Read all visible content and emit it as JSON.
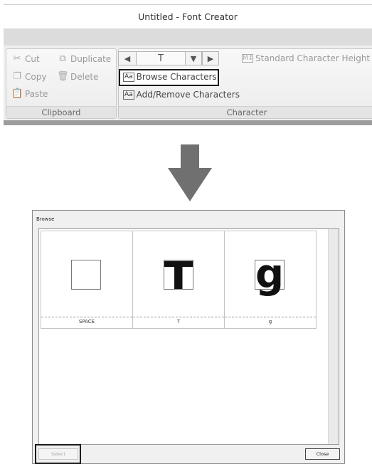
{
  "window": {
    "title": "Untitled - Font Creator"
  },
  "clipboard": {
    "label": "Clipboard",
    "cut": "Cut",
    "duplicate": "Duplicate",
    "copy": "Copy",
    "delete": "Delete",
    "paste": "Paste"
  },
  "character": {
    "label": "Character",
    "current_char": "T",
    "standard_height": "Standard Character Height",
    "browse": "Browse Characters",
    "add_remove": "Add/Remove Characters"
  },
  "icons": {
    "cut": "scissors-icon",
    "duplicate": "duplicate-icon",
    "copy": "copy-icon",
    "delete": "trash-icon",
    "paste": "paste-icon",
    "prev": "arrow-left-icon",
    "dropdown": "chevron-down-icon",
    "next": "arrow-right-icon",
    "height": "height-icon",
    "browse": "aa-icon",
    "add_remove": "aa-add-icon"
  },
  "dialog": {
    "title": "Browse",
    "items": [
      {
        "caption": "SPACE",
        "glyph": ""
      },
      {
        "caption": "T",
        "glyph": "T"
      },
      {
        "caption": "g",
        "glyph": "g"
      }
    ],
    "select": "Select",
    "close": "Close"
  },
  "colors": {
    "highlight_border": "#1a1a1a",
    "arrow": "#707070",
    "ribbon_bg": "#eeeeee"
  }
}
